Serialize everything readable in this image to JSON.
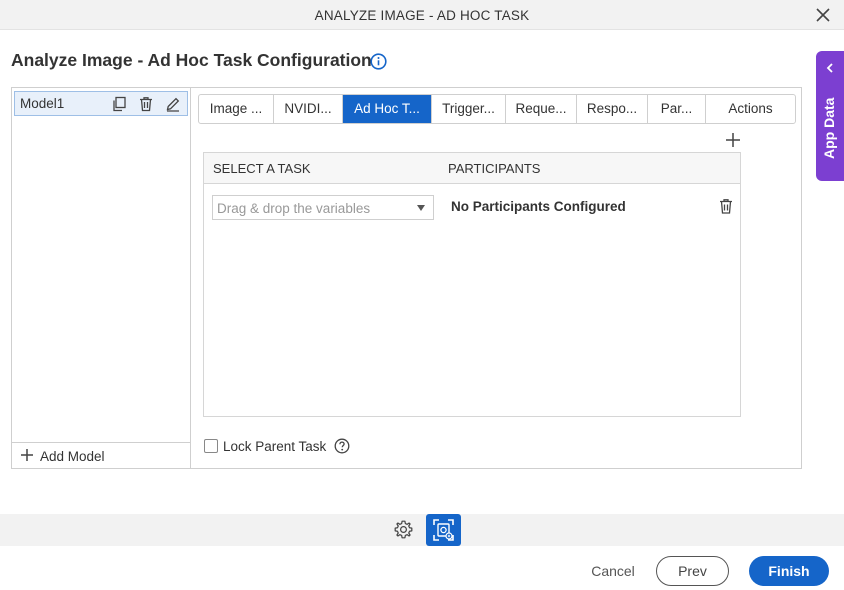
{
  "window": {
    "title": "ANALYZE IMAGE - AD HOC TASK"
  },
  "page": {
    "heading": "Analyze Image - Ad Hoc Task Configuration"
  },
  "side_panel": {
    "label": "App Data"
  },
  "models": {
    "items": [
      {
        "label": "Model1"
      }
    ],
    "add_label": "Add Model"
  },
  "tabs": [
    {
      "label": "Image ...",
      "active": false
    },
    {
      "label": "NVIDI...",
      "active": false
    },
    {
      "label": "Ad Hoc T...",
      "active": true
    },
    {
      "label": "Trigger...",
      "active": false
    },
    {
      "label": "Reque...",
      "active": false
    },
    {
      "label": "Respo...",
      "active": false
    },
    {
      "label": "Par...",
      "active": false
    },
    {
      "label": "Actions",
      "active": false
    }
  ],
  "task_grid": {
    "columns": [
      "SELECT A TASK",
      "PARTICIPANTS"
    ],
    "rows": [
      {
        "task_placeholder": "Drag & drop the variables",
        "participants": "No Participants Configured"
      }
    ]
  },
  "lock_parent": {
    "label": "Lock Parent Task",
    "checked": false
  },
  "footer": {
    "cancel": "Cancel",
    "prev": "Prev",
    "finish": "Finish"
  },
  "colors": {
    "accent": "#1565c9",
    "app_data": "#7c3fd1"
  }
}
